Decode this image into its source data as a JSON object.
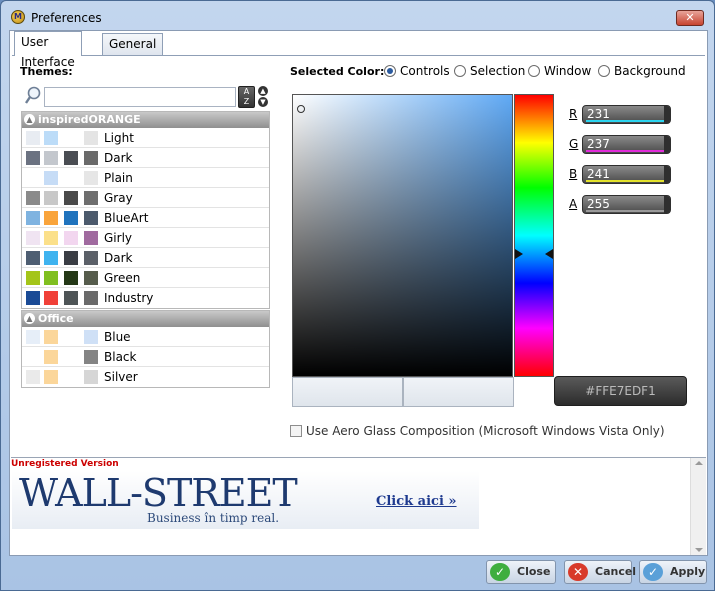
{
  "window": {
    "title": "Preferences",
    "close_glyph": "✕"
  },
  "tabs": [
    {
      "label": "User Interface"
    },
    {
      "label": "General"
    }
  ],
  "themes": {
    "label": "Themes:",
    "search_value": "",
    "groups": [
      {
        "name": "inspiredORANGE",
        "rows": [
          {
            "name": "Light",
            "colors": [
              "#e8ecf2",
              "#bcdcf8",
              "#ffffff",
              "#e4e4e4"
            ]
          },
          {
            "name": "Dark",
            "colors": [
              "#6b7281",
              "#c3c7cd",
              "#4a4d53",
              "#6a6a6a"
            ]
          },
          {
            "name": "Plain",
            "colors": [
              "#ffffff",
              "#c6dcf6",
              "#ffffff",
              "#e6e6e6"
            ]
          },
          {
            "name": "Gray",
            "colors": [
              "#8a8a8a",
              "#c8c8c8",
              "#4a4a4a",
              "#6e6e6e"
            ]
          },
          {
            "name": "BlueArt",
            "colors": [
              "#7fb3e0",
              "#f9a43b",
              "#2073bd",
              "#4c5a6c"
            ]
          },
          {
            "name": "Girly",
            "colors": [
              "#f0e4f2",
              "#fbe08a",
              "#f2d6ef",
              "#a06a9f"
            ]
          },
          {
            "name": "Dark",
            "colors": [
              "#4e5e72",
              "#3fb3ef",
              "#3a3d44",
              "#5b6068"
            ]
          },
          {
            "name": "Green",
            "colors": [
              "#a4c519",
              "#80bf20",
              "#243816",
              "#565c4c"
            ]
          },
          {
            "name": "Industry",
            "colors": [
              "#1b4b96",
              "#f04038",
              "#4e5456",
              "#6a6a6a"
            ]
          }
        ]
      },
      {
        "name": "Office",
        "rows": [
          {
            "name": "Blue",
            "colors": [
              "#e6eef8",
              "#fbd69a",
              "#ffffff",
              "#cfe0f6"
            ]
          },
          {
            "name": "Black",
            "colors": [
              "#ffffff",
              "#fbd69a",
              "#ffffff",
              "#848484"
            ]
          },
          {
            "name": "Silver",
            "colors": [
              "#eaeaea",
              "#fbd69a",
              "#ffffff",
              "#d6d6d6"
            ]
          }
        ]
      }
    ]
  },
  "selected_color": {
    "label": "Selected Color:",
    "options": [
      {
        "label": "Controls",
        "checked": true
      },
      {
        "label": "Selection",
        "checked": false
      },
      {
        "label": "Window",
        "checked": false
      },
      {
        "label": "Background",
        "checked": false
      }
    ],
    "channels": [
      {
        "letter": "R",
        "value": "231",
        "color": "#2bd4ef"
      },
      {
        "letter": "G",
        "value": "237",
        "color": "#e12bd9"
      },
      {
        "letter": "B",
        "value": "241",
        "color": "#e3e22b"
      },
      {
        "letter": "A",
        "value": "255",
        "color": "#9a9a9a"
      }
    ],
    "hex": "#FFE7EDF1"
  },
  "aero_label": "Use Aero Glass Composition (Microsoft Windows Vista Only)",
  "ad": {
    "unregistered": "Unregistered Version",
    "brand": "WALL-STREET",
    "slogan": "Business în timp real.",
    "click": "Click aici »"
  },
  "buttons": {
    "close": "Close",
    "cancel": "Cancel",
    "apply": "Apply"
  },
  "icons": {
    "search": "magnifier-icon",
    "sort": "sort-az-icon"
  }
}
